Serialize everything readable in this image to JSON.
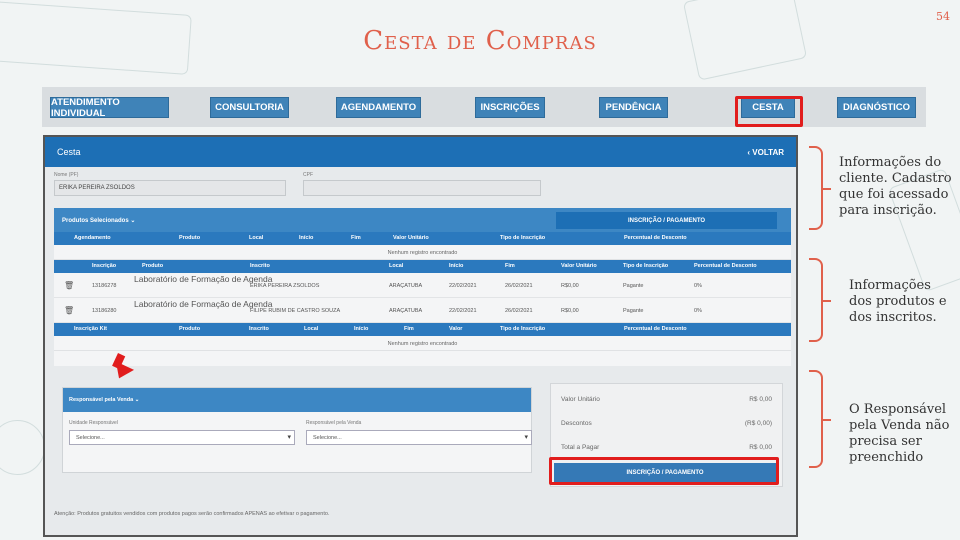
{
  "slide": {
    "title": "Cesta de Compras",
    "number": "54"
  },
  "nav": [
    "ATENDIMENTO INDIVIDUAL",
    "CONSULTORIA",
    "AGENDAMENTO",
    "INSCRIÇÕES",
    "PENDÊNCIA",
    "CESTA",
    "DIAGNÓSTICO"
  ],
  "screen": {
    "title": "Cesta",
    "back": "‹ VOLTAR",
    "name_label": "Nome (PF)",
    "name_value": "ERIKA PEREIRA ZSOLDOS",
    "cpf_label": "CPF",
    "cpf_value": "",
    "products_selected": "Produtos Selecionados ⌄",
    "pay_button": "INSCRIÇÃO / PAGAMENTO",
    "table1_headers": [
      "Agendamento",
      "Produto",
      "Local",
      "Início",
      "Fim",
      "Valor Unitário",
      "Tipo de Inscrição",
      "Percentual de Desconto"
    ],
    "empty": "Nenhum registro encontrado",
    "table2_headers": [
      "Inscrição",
      "Produto",
      "Inscrito",
      "Local",
      "Início",
      "Fim",
      "Valor Unitário",
      "Tipo de Inscrição",
      "Percentual de Desconto"
    ],
    "rows": [
      {
        "trash": "🗑",
        "code": "13186278",
        "product": "Laboratório de Formação de Agenda",
        "person": "ERIKA PEREIRA ZSOLDOS",
        "local": "ARAÇATUBA",
        "start": "22/02/2021",
        "end": "26/02/2021",
        "value": "R$0,00",
        "type": "Pagante",
        "discount": "0%"
      },
      {
        "trash": "🗑",
        "code": "13186280",
        "product": "Laboratório de Formação de Agenda",
        "person": "FILIPE RUBIM DE CASTRO SOUZA",
        "local": "ARAÇATUBA",
        "start": "22/02/2021",
        "end": "26/02/2021",
        "value": "R$0,00",
        "type": "Pagante",
        "discount": "0%"
      }
    ],
    "table3_headers": [
      "Inscrição Kit",
      "Produto",
      "Inscrito",
      "Local",
      "Início",
      "Fim",
      "Valor",
      "Tipo de Inscrição",
      "Percentual de Desconto"
    ],
    "resp_title": "Responsável pela Venda ⌄",
    "unit_label": "Unidade Responsável",
    "unit_value": "Selecione...",
    "seller_label": "Responsável pela Venda",
    "seller_value": "Selecione...",
    "totals": [
      {
        "label": "Valor Unitário",
        "value": "R$ 0,00"
      },
      {
        "label": "Descontos",
        "value": "(R$ 0,00)"
      },
      {
        "label": "Total a Pagar",
        "value": "R$ 0,00"
      }
    ],
    "footer": "Atenção:  Produtos gratuitos vendidos com produtos pagos serão confirmados APENAS ao efetivar o pagamento."
  },
  "notes": {
    "n1": "Informações do cliente. Cadastro que foi acessado para inscrição.",
    "n2": "Informações dos produtos e dos inscritos.",
    "n3": "O Responsável pela Venda não precisa ser preenchido"
  }
}
